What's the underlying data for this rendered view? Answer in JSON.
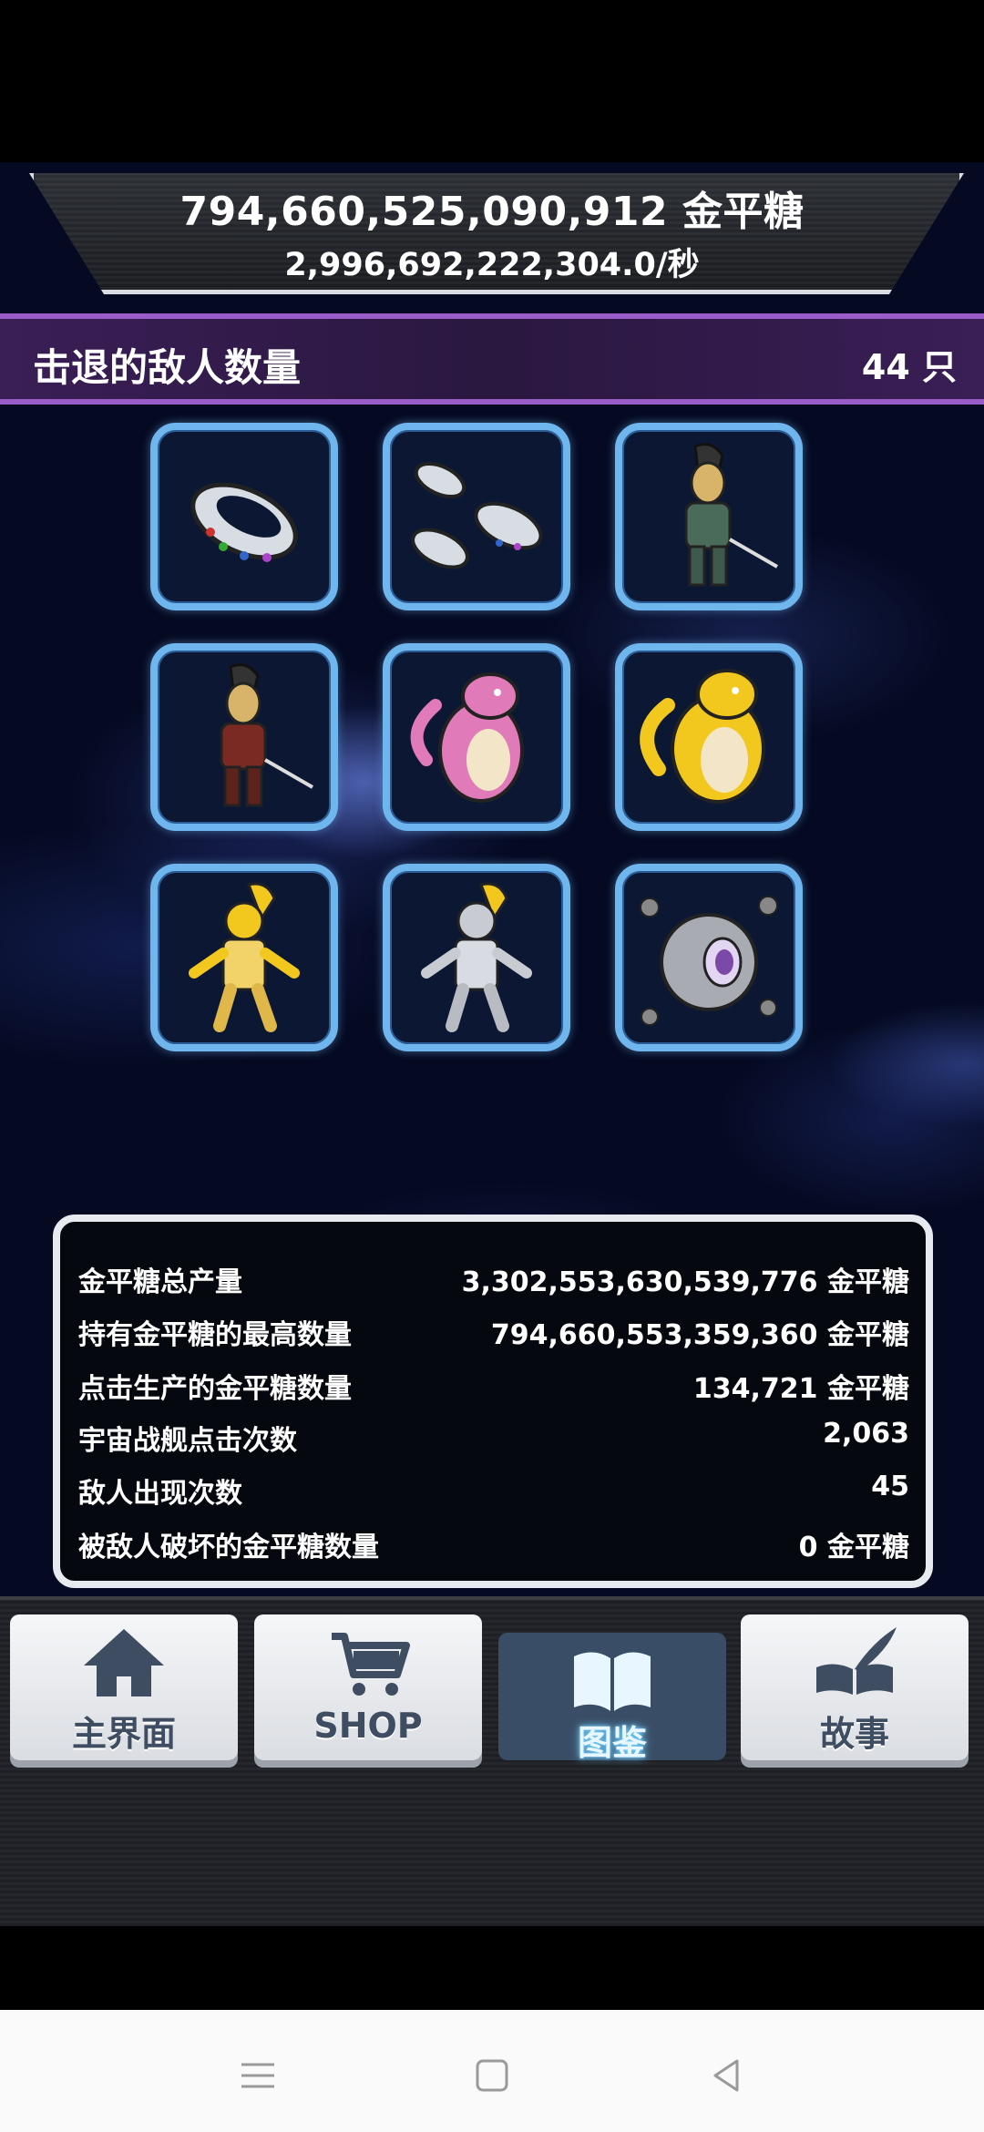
{
  "header": {
    "total_amount": "794,660,525,090,912 金平糖",
    "per_second": "2,996,692,222,304.0/秒"
  },
  "kill_bar": {
    "title": "击退的敌人数量",
    "count": "44 只",
    "accent_color": "#9a5cc8"
  },
  "enemies": [
    {
      "icon": "ufo-ship-icon"
    },
    {
      "icon": "ufo-fleet-icon"
    },
    {
      "icon": "green-armored-alien-icon"
    },
    {
      "icon": "red-armored-alien-icon"
    },
    {
      "icon": "pink-dragon-icon"
    },
    {
      "icon": "yellow-dragon-icon"
    },
    {
      "icon": "yellow-rabbit-warrior-icon"
    },
    {
      "icon": "white-rabbit-warrior-icon"
    },
    {
      "icon": "eye-planet-icon"
    }
  ],
  "stats": [
    {
      "label": "金平糖总产量",
      "value": "3,302,553,630,539,776 金平糖"
    },
    {
      "label": "持有金平糖的最高数量",
      "value": "794,660,553,359,360 金平糖"
    },
    {
      "label": "点击生产的金平糖数量",
      "value": "134,721 金平糖"
    },
    {
      "label": "宇宙战舰点击次数",
      "value": "2,063"
    },
    {
      "label": "敌人出现次数",
      "value": "45"
    },
    {
      "label": "被敌人破坏的金平糖数量",
      "value": "0 金平糖"
    }
  ],
  "nav": [
    {
      "label": "主界面",
      "icon": "home-icon",
      "active": false
    },
    {
      "label": "SHOP",
      "icon": "cart-icon",
      "active": false
    },
    {
      "label": "图鉴",
      "icon": "book-icon",
      "active": true
    },
    {
      "label": "故事",
      "icon": "quill-book-icon",
      "active": false
    }
  ],
  "system_nav": [
    {
      "icon": "menu-icon"
    },
    {
      "icon": "home-square-icon"
    },
    {
      "icon": "back-triangle-icon"
    }
  ]
}
